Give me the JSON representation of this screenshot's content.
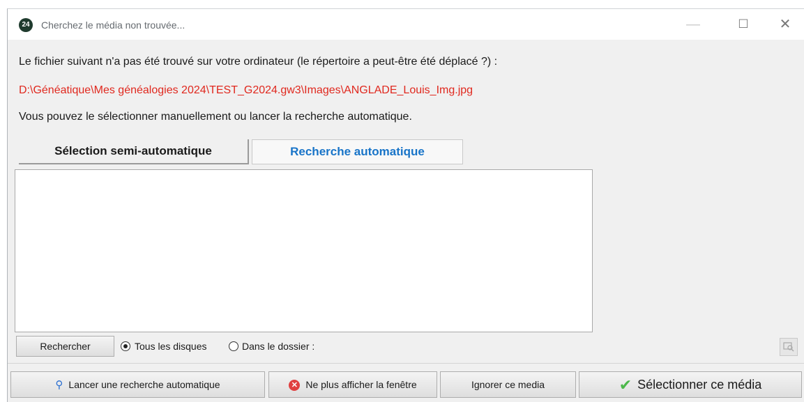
{
  "window": {
    "title": "Cherchez le média non trouvée...",
    "app_icon_label": "24"
  },
  "message": {
    "line1": "Le fichier suivant n'a pas été trouvé sur votre ordinateur (le répertoire a peut-être été déplacé ?) :",
    "path": "D:\\Généatique\\Mes généalogies 2024\\TEST_G2024.gw3\\Images\\ANGLADE_Louis_Img.jpg",
    "line3": "Vous pouvez le sélectionner manuellement ou lancer la recherche automatique."
  },
  "tabs": [
    {
      "label": "Sélection semi-automatique"
    },
    {
      "label": "Recherche automatique",
      "active": true
    }
  ],
  "search": {
    "button_label": "Rechercher",
    "option_all_label": "Tous les disques",
    "option_all_checked": true,
    "option_folder_label": "Dans le dossier :"
  },
  "buttons": {
    "auto_search": "Lancer une recherche automatique",
    "hide_window": "Ne plus afficher la fenêtre",
    "ignore_media": "Ignorer ce media",
    "select_media": "Sélectionner ce média"
  },
  "colors": {
    "path_red": "#e0281e",
    "active_tab_blue": "#1874c8",
    "check_green": "#4cb84a"
  }
}
